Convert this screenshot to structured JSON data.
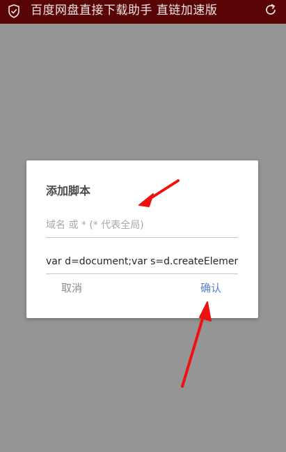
{
  "status_bar": {
    "title": "百度网盘直接下载助手 直链加速版",
    "left_icon": "shield-check-icon",
    "right_icon": "refresh-icon",
    "background_color": "#5a0505"
  },
  "dialog": {
    "title": "添加脚本",
    "domain_field": {
      "value": "",
      "placeholder": "域名 或 * (* 代表全局)"
    },
    "script_field": {
      "value": "var d=document;var s=d.createElemen",
      "placeholder": ""
    },
    "cancel_label": "取消",
    "confirm_label": "确认"
  },
  "annotations": {
    "arrow_color": "#ee1111"
  }
}
